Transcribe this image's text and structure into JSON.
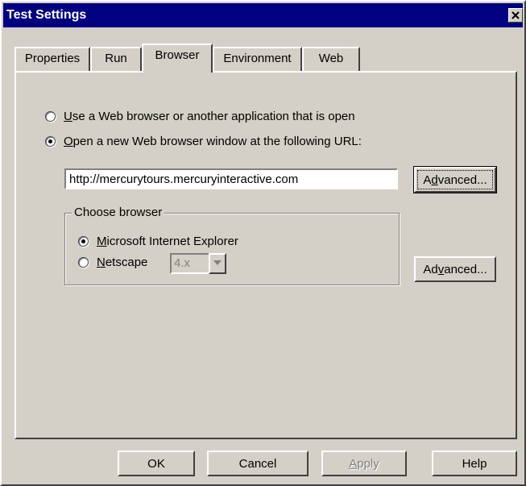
{
  "window": {
    "title": "Test Settings"
  },
  "tabs": [
    {
      "label": "Properties",
      "active": false
    },
    {
      "label": "Run",
      "active": false
    },
    {
      "label": "Browser",
      "active": true
    },
    {
      "label": "Environment",
      "active": false
    },
    {
      "label": "Web",
      "active": false
    }
  ],
  "browser_tab": {
    "option_open_app": {
      "mnemonic": "U",
      "label_rest": "se a Web browser or another application that is open",
      "checked": false
    },
    "option_new_window": {
      "mnemonic": "O",
      "label_rest": "pen a new Web browser window at the following URL:",
      "checked": true
    },
    "url_value": "http://mercurytours.mercuryinteractive.com",
    "advanced_url": {
      "before": "A",
      "mnemonic": "d",
      "after": "vanced..."
    },
    "choose_browser": {
      "label": "Choose browser",
      "ie": {
        "mnemonic": "M",
        "label_rest": "icrosoft Internet Explorer",
        "checked": true
      },
      "netscape": {
        "mnemonic": "N",
        "label_rest": "etscape",
        "checked": false
      },
      "netscape_version": "4.x"
    },
    "advanced_browser": {
      "before": "Ad",
      "mnemonic": "v",
      "after": "anced..."
    }
  },
  "buttons": {
    "ok": "OK",
    "cancel": "Cancel",
    "apply_mnemonic": "A",
    "apply_rest": "pply",
    "help": "Help"
  }
}
